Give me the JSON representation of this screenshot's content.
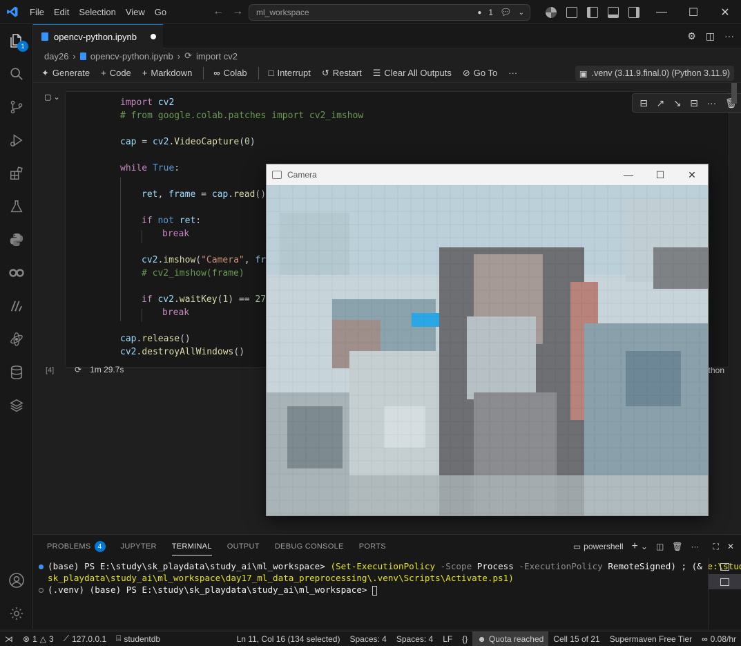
{
  "titlebar": {
    "menu": [
      "File",
      "Edit",
      "Selection",
      "View",
      "Go"
    ],
    "search_text": "ml_workspace",
    "notif_count": "1"
  },
  "activity": {
    "explorer_badge": "1"
  },
  "tab": {
    "filename": "opencv-python.ipynb"
  },
  "breadcrumb": {
    "folder": "day26",
    "file": "opencv-python.ipynb",
    "symbol": "import cv2"
  },
  "notebook_toolbar": {
    "generate": "Generate",
    "code": "Code",
    "markdown": "Markdown",
    "colab": "Colab",
    "interrupt": "Interrupt",
    "restart": "Restart",
    "clear": "Clear All Outputs",
    "goto": "Go To",
    "more": "···",
    "kernel": ".venv (3.11.9.final.0) (Python 3.11.9)"
  },
  "cell": {
    "exec_count": "[4]",
    "duration": "1m 29.7s",
    "language": "Python"
  },
  "camera": {
    "title": "Camera"
  },
  "panel": {
    "tabs": [
      "PROBLEMS",
      "JUPYTER",
      "TERMINAL",
      "OUTPUT",
      "DEBUG CONSOLE",
      "PORTS"
    ],
    "problems_count": "4",
    "shell": "powershell",
    "line1_prompt": "(base) PS E:\\study\\sk_playdata\\study_ai\\ml_workspace> ",
    "line1_cmd": "(Set-ExecutionPolicy",
    "line1_scope_flag": " -Scope ",
    "line1_scope": "Process",
    "line1_policy_flag": " -ExecutionPolicy ",
    "line1_policy": "RemoteSigned) ; (& ",
    "line1_path": "e:\\study\\",
    "line2_path": "sk_playdata\\study_ai\\ml_workspace\\day17_ml_data_preprocessing\\.venv\\Scripts\\Activate.ps1)",
    "line3_prompt": "(.venv) (base) PS E:\\study\\sk_playdata\\study_ai\\ml_workspace> "
  },
  "statusbar": {
    "errors": "1",
    "warnings": "3",
    "host": "127.0.0.1",
    "db": "studentdb",
    "position": "Ln 11, Col 16 (134 selected)",
    "spaces1": "Spaces: 4",
    "spaces2": "Spaces: 4",
    "eol": "LF",
    "lang": "{}",
    "quota": "Quota reached",
    "cell": "Cell 15 of 21",
    "supermaven": "Supermaven Free Tier",
    "rate": "0.08/hr"
  }
}
